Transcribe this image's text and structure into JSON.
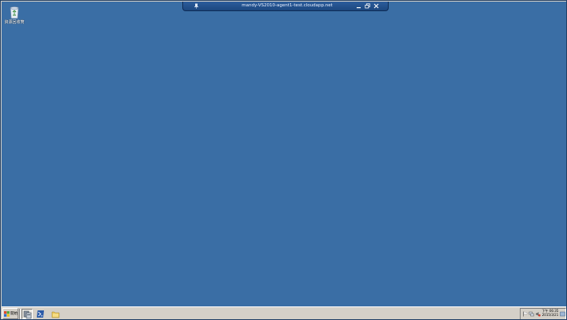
{
  "desktop": {
    "background_color": "#3a6ea5",
    "icons": [
      {
        "label": "資源回收筒",
        "icon": "recycle-bin-icon"
      }
    ]
  },
  "rdp_bar": {
    "title": "mandy-VS2010-agent1-test.cloudapp.net",
    "pin_icon": "pin-icon",
    "minimize_icon": "minimize-icon",
    "restore_icon": "restore-icon",
    "close_icon": "close-icon"
  },
  "taskbar": {
    "start_label": "開始",
    "quick_launch": [
      {
        "icon": "server-manager-icon"
      },
      {
        "icon": "powershell-icon"
      },
      {
        "icon": "explorer-folder-icon"
      }
    ],
    "tray": {
      "icons": [
        "flag-icon",
        "network-icon",
        "volume-icon"
      ],
      "clock_line1": "下午 06:35",
      "clock_line2": "2015/3/21"
    }
  }
}
